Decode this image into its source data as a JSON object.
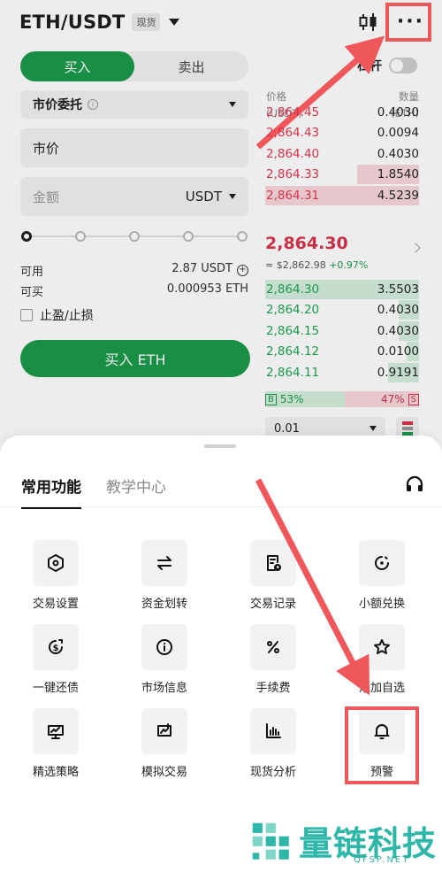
{
  "header": {
    "pair": "ETH/USDT",
    "market_tag": "现货"
  },
  "trade_form": {
    "buy_tab": "买入",
    "sell_tab": "卖出",
    "leverage_label": "杠杆",
    "order_type": "市价委托",
    "price_field": "市价",
    "amount_placeholder": "金额",
    "amount_unit": "USDT",
    "available_label": "可用",
    "available_value": "2.87 USDT",
    "buyable_label": "可买",
    "buyable_value": "0.000953 ETH",
    "tpsl_label": "止盈/止损",
    "buy_button": "买入 ETH"
  },
  "orderbook": {
    "price_header": "价格",
    "price_unit": "(USDT)",
    "qty_header": "数量",
    "qty_unit": "(ETH)",
    "asks": [
      {
        "price": "2,864.45",
        "qty": "0.4030",
        "depth": 0
      },
      {
        "price": "2,864.43",
        "qty": "0.0094",
        "depth": 0
      },
      {
        "price": "2,864.40",
        "qty": "0.4030",
        "depth": 0
      },
      {
        "price": "2,864.33",
        "qty": "1.8540",
        "depth": 0.4
      },
      {
        "price": "2,864.31",
        "qty": "4.5239",
        "depth": 1.0
      }
    ],
    "last_price": "2,864.30",
    "last_sub": "≈ $2,862.98",
    "last_change": "+0.97%",
    "bids": [
      {
        "price": "2,864.30",
        "qty": "3.5503",
        "depth": 1.0
      },
      {
        "price": "2,864.20",
        "qty": "0.4030",
        "depth": 0.13
      },
      {
        "price": "2,864.15",
        "qty": "0.4030",
        "depth": 0.13
      },
      {
        "price": "2,864.12",
        "qty": "0.0100",
        "depth": 0.08
      },
      {
        "price": "2,864.11",
        "qty": "0.9191",
        "depth": 0.2
      }
    ],
    "buy_ratio_tag": "B",
    "buy_ratio": "53%",
    "sell_ratio": "47%",
    "sell_ratio_tag": "S",
    "precision": "0.01"
  },
  "sheet": {
    "tabs": [
      "常用功能",
      "教学中心"
    ],
    "functions": [
      {
        "label": "交易设置",
        "icon": "hexagon-settings-icon"
      },
      {
        "label": "资金划转",
        "icon": "transfer-arrows-icon"
      },
      {
        "label": "交易记录",
        "icon": "record-clock-icon"
      },
      {
        "label": "小额兑换",
        "icon": "small-exchange-icon"
      },
      {
        "label": "一键还债",
        "icon": "repay-dollar-icon"
      },
      {
        "label": "市场信息",
        "icon": "info-circle-icon"
      },
      {
        "label": "手续费",
        "icon": "percent-icon"
      },
      {
        "label": "添加自选",
        "icon": "star-icon"
      },
      {
        "label": "精选策略",
        "icon": "strategy-chart-icon"
      },
      {
        "label": "模拟交易",
        "icon": "demo-trade-icon"
      },
      {
        "label": "现货分析",
        "icon": "bar-chart-icon"
      },
      {
        "label": "预警",
        "icon": "bell-icon"
      }
    ]
  },
  "watermark": {
    "name": "量链科技",
    "site": "QFSP.NET"
  },
  "colors": {
    "buy_green": "#1b9a4c",
    "sell_red": "#d8324a",
    "annotation_red": "#f0575a",
    "watermark_teal": "#2eb7a8"
  }
}
